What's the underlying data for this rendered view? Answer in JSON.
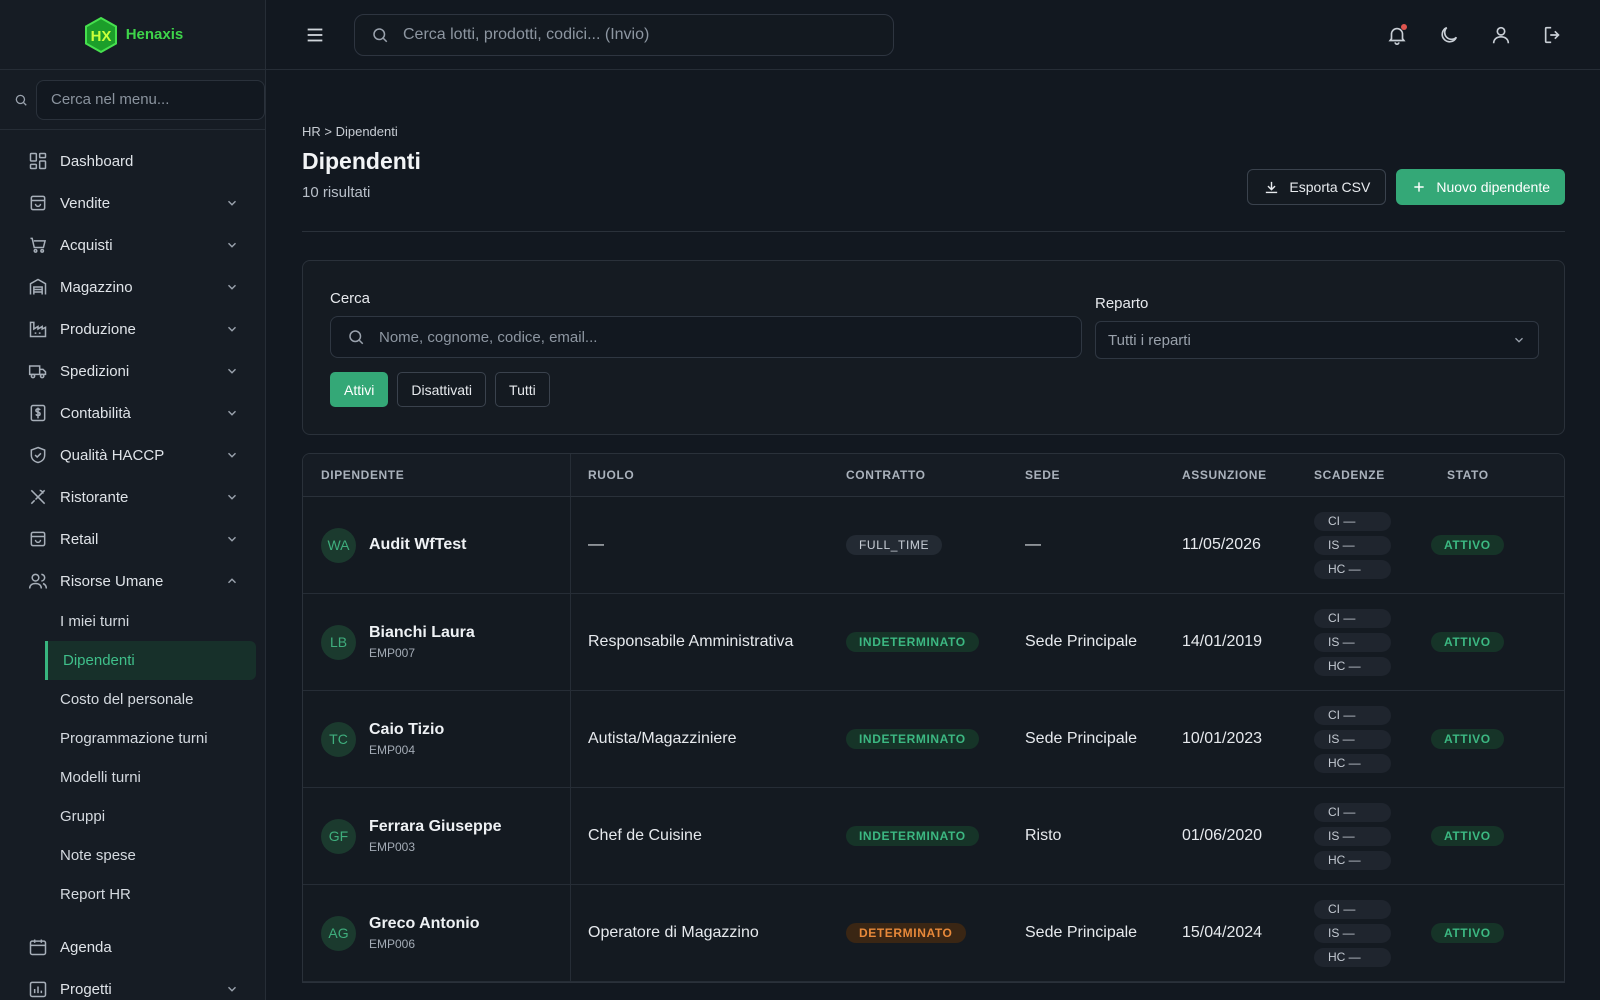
{
  "brand": {
    "name": "Henaxis",
    "logo_letters": "HX"
  },
  "sidebar": {
    "search_placeholder": "Cerca nel menu...",
    "items": [
      {
        "label": "Dashboard",
        "icon": "dashboard-icon",
        "expandable": false
      },
      {
        "label": "Vendite",
        "icon": "shopping-bag-icon",
        "expandable": true
      },
      {
        "label": "Acquisti",
        "icon": "cart-icon",
        "expandable": true
      },
      {
        "label": "Magazzino",
        "icon": "warehouse-icon",
        "expandable": true
      },
      {
        "label": "Produzione",
        "icon": "factory-icon",
        "expandable": true
      },
      {
        "label": "Spedizioni",
        "icon": "truck-icon",
        "expandable": true
      },
      {
        "label": "Contabilità",
        "icon": "dollar-icon",
        "expandable": true
      },
      {
        "label": "Qualità HACCP",
        "icon": "shield-icon",
        "expandable": true
      },
      {
        "label": "Ristorante",
        "icon": "utensils-icon",
        "expandable": true
      },
      {
        "label": "Retail",
        "icon": "store-icon",
        "expandable": true
      },
      {
        "label": "Risorse Umane",
        "icon": "users-icon",
        "expandable": true,
        "expanded": true
      }
    ],
    "hr_sub_items": [
      "I miei turni",
      "Dipendenti",
      "Costo del personale",
      "Programmazione turni",
      "Modelli turni",
      "Gruppi",
      "Note spese",
      "Report HR"
    ],
    "active_sub_item": "Dipendenti",
    "bottom_items": [
      {
        "label": "Agenda",
        "icon": "calendar-icon",
        "expandable": false
      },
      {
        "label": "Progetti",
        "icon": "chart-icon",
        "expandable": true
      }
    ]
  },
  "topbar": {
    "search_placeholder": "Cerca lotti, prodotti, codici... (Invio)",
    "icons": [
      "bell-icon",
      "moon-icon",
      "user-icon",
      "logout-icon"
    ]
  },
  "page": {
    "breadcrumb": "HR > Dipendenti",
    "title": "Dipendenti",
    "results": "10 risultati",
    "export_label": "Esporta CSV",
    "new_label": "Nuovo dipendente"
  },
  "filters": {
    "search_label": "Cerca",
    "search_placeholder": "Nome, cognome, codice, email...",
    "dept_label": "Reparto",
    "dept_value": "Tutti i reparti",
    "segments": [
      "Attivi",
      "Disattivati",
      "Tutti"
    ],
    "active_segment": "Attivi"
  },
  "table": {
    "headers": [
      "DIPENDENTE",
      "RUOLO",
      "CONTRATTO",
      "SEDE",
      "ASSUNZIONE",
      "SCADENZE",
      "STATO"
    ],
    "rows": [
      {
        "initials": "WA",
        "name": "Audit WfTest",
        "code": "",
        "role": "—",
        "contract": "FULL_TIME",
        "contract_style": "gray",
        "site": "—",
        "hired": "11/05/2026",
        "deadlines": [
          "CI —",
          "IS —",
          "HC —"
        ],
        "status": "ATTIVO"
      },
      {
        "initials": "LB",
        "name": "Bianchi Laura",
        "code": "EMP007",
        "role": "Responsabile Amministrativa",
        "contract": "INDETERMINATO",
        "contract_style": "green",
        "site": "Sede Principale",
        "hired": "14/01/2019",
        "deadlines": [
          "CI —",
          "IS —",
          "HC —"
        ],
        "status": "ATTIVO"
      },
      {
        "initials": "TC",
        "name": "Caio Tizio",
        "code": "EMP004",
        "role": "Autista/Magazziniere",
        "contract": "INDETERMINATO",
        "contract_style": "green",
        "site": "Sede Principale",
        "hired": "10/01/2023",
        "deadlines": [
          "CI —",
          "IS —",
          "HC —"
        ],
        "status": "ATTIVO"
      },
      {
        "initials": "GF",
        "name": "Ferrara Giuseppe",
        "code": "EMP003",
        "role": "Chef de Cuisine",
        "contract": "INDETERMINATO",
        "contract_style": "green",
        "site": "Risto",
        "hired": "01/06/2020",
        "deadlines": [
          "CI —",
          "IS —",
          "HC —"
        ],
        "status": "ATTIVO"
      },
      {
        "initials": "AG",
        "name": "Greco Antonio",
        "code": "EMP006",
        "role": "Operatore di Magazzino",
        "contract": "DETERMINATO",
        "contract_style": "orange",
        "site": "Sede Principale",
        "hired": "15/04/2024",
        "deadlines": [
          "CI —",
          "IS —",
          "HC —"
        ],
        "status": "ATTIVO"
      }
    ]
  },
  "colors": {
    "accent": "#34a877",
    "brand": "#3ed44a",
    "background": "#121820",
    "sidebar": "#161c24",
    "warning": "#e8893a"
  }
}
